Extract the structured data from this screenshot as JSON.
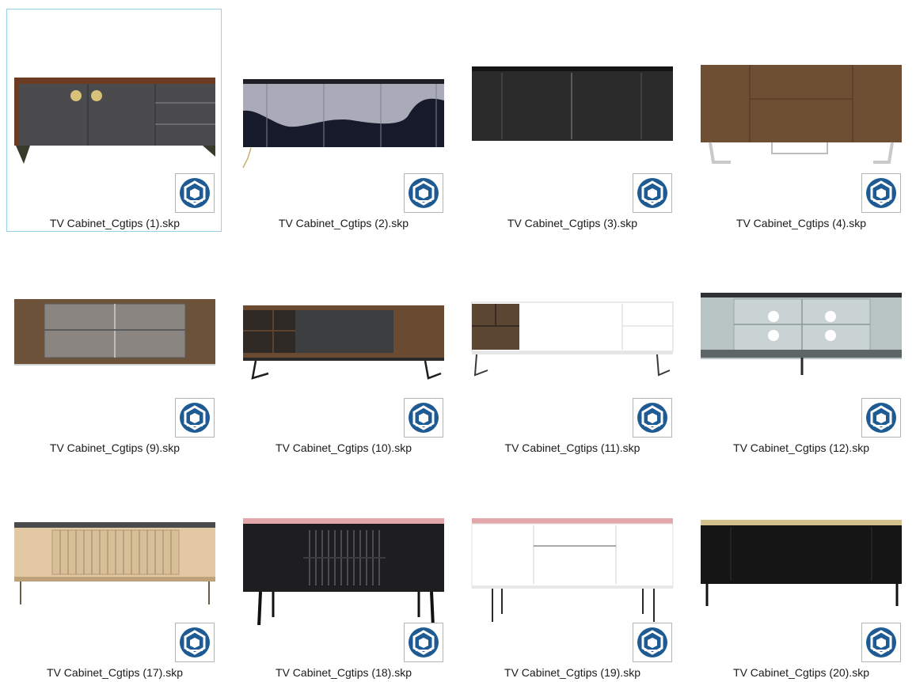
{
  "files": [
    {
      "name": "TV Cabinet_Cgtips (1).skp",
      "selected": true
    },
    {
      "name": "TV Cabinet_Cgtips (2).skp",
      "selected": false
    },
    {
      "name": "TV Cabinet_Cgtips (3).skp",
      "selected": false
    },
    {
      "name": "TV Cabinet_Cgtips (4).skp",
      "selected": false
    },
    {
      "name": "TV Cabinet_Cgtips (9).skp",
      "selected": false
    },
    {
      "name": "TV Cabinet_Cgtips (10).skp",
      "selected": false
    },
    {
      "name": "TV Cabinet_Cgtips (11).skp",
      "selected": false
    },
    {
      "name": "TV Cabinet_Cgtips (12).skp",
      "selected": false
    },
    {
      "name": "TV Cabinet_Cgtips (17).skp",
      "selected": false
    },
    {
      "name": "TV Cabinet_Cgtips (18).skp",
      "selected": false
    },
    {
      "name": "TV Cabinet_Cgtips (19).skp",
      "selected": false
    },
    {
      "name": "TV Cabinet_Cgtips (20).skp",
      "selected": false
    }
  ],
  "file_icon": "sketchup-file-icon",
  "colors": {
    "selection_border": "#99d1ea",
    "sketchup_blue": "#1f5b93"
  }
}
